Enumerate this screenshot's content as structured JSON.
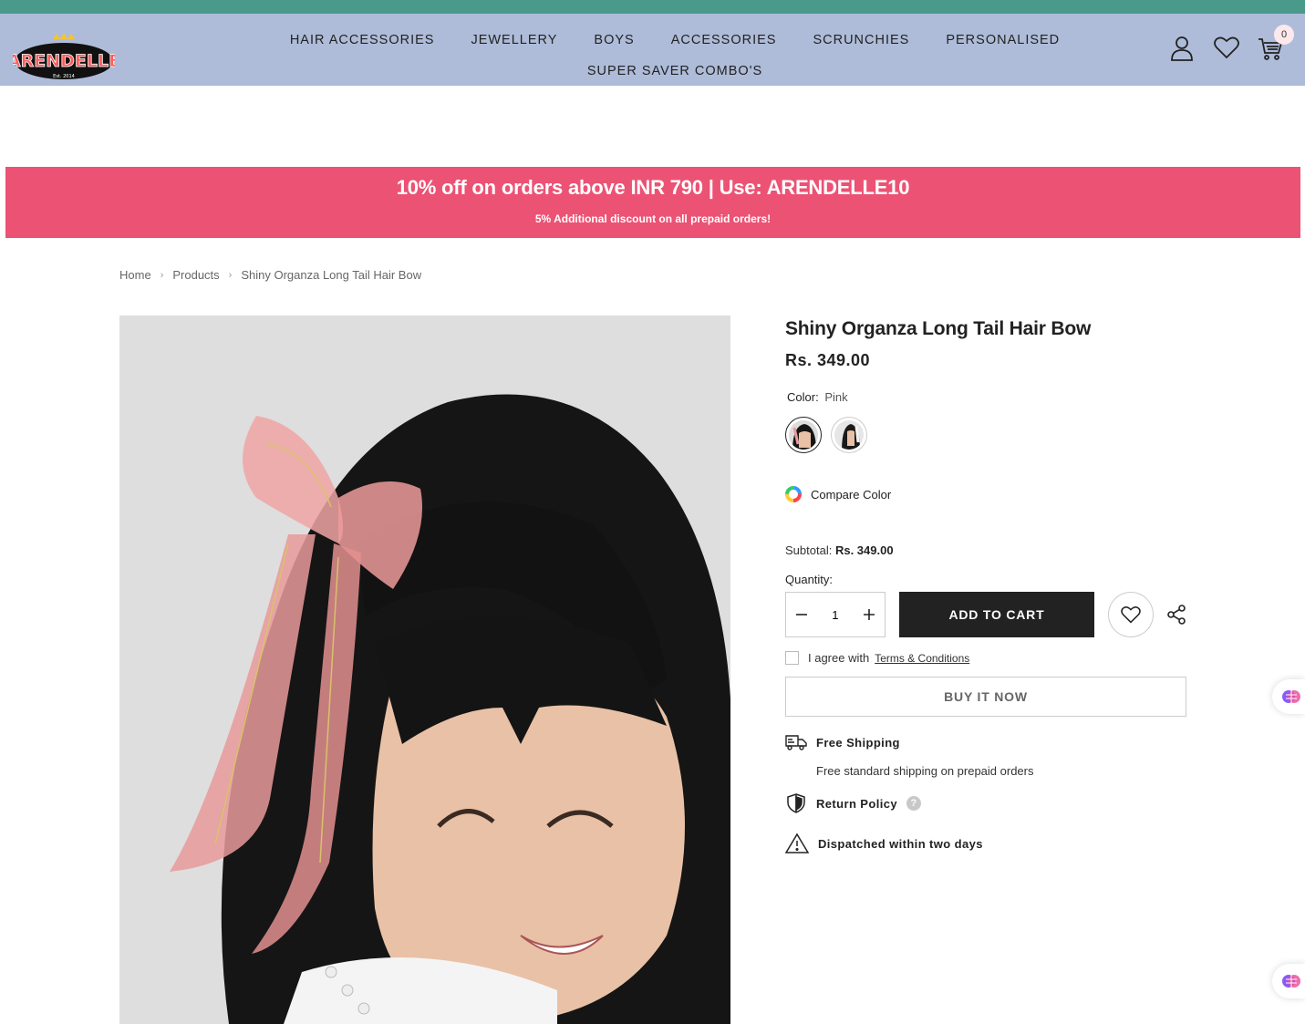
{
  "brand": {
    "logo_text": "ARENDELLE",
    "logo_tag": "Est. 2014"
  },
  "nav": {
    "row1": [
      "HAIR ACCESSORIES",
      "JEWELLERY",
      "BOYS",
      "ACCESSORIES",
      "SCRUNCHIES",
      "PERSONALISED"
    ],
    "row2": [
      "SUPER SAVER COMBO'S"
    ]
  },
  "header_icons": {
    "account": "user-icon",
    "wishlist": "heart-icon",
    "cart": "cart-icon",
    "cart_count": "0"
  },
  "promo": {
    "main": "10% off on orders above INR 790 | Use: ARENDELLE10",
    "sub": "5% Additional discount on all prepaid orders!",
    "bg_color": "#ec5274"
  },
  "breadcrumb": [
    "Home",
    "Products",
    "Shiny Organza Long Tail Hair Bow"
  ],
  "product": {
    "title": "Shiny Organza Long Tail Hair Bow",
    "price": "Rs. 349.00",
    "color_label": "Color:",
    "color_value": "Pink",
    "compare_color": "Compare Color",
    "subtotal_label": "Subtotal:",
    "subtotal_value": "Rs. 349.00",
    "quantity_label": "Quantity:",
    "quantity_value": "1",
    "add_to_cart": "ADD TO CART",
    "agree_text": "I agree with",
    "terms_link": "Terms & Conditions",
    "buy_now": "BUY IT NOW"
  },
  "features": {
    "shipping_title": "Free Shipping",
    "shipping_sub": "Free standard shipping on prepaid orders",
    "return_title": "Return Policy",
    "dispatch_title": "Dispatched within two days"
  },
  "colors": {
    "header_bg": "#aebcd9",
    "top_strip": "#4a9a8c",
    "button_dark": "#222222"
  }
}
